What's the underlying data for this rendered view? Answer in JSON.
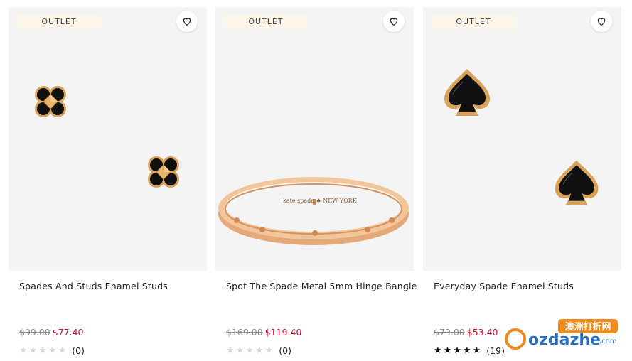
{
  "products": [
    {
      "badge": "OUTLET",
      "name": "Spades And Studs Enamel Studs",
      "old_price": "$99.00",
      "new_price": "$77.40",
      "rating_count": "(0)",
      "stars_filled": 0
    },
    {
      "badge": "OUTLET",
      "name": "Spot The Spade Metal 5mm Hinge Bangle",
      "old_price": "$169.00",
      "new_price": "$119.40",
      "rating_count": "(0)",
      "stars_filled": 0,
      "engraving": "kate spade ♠ NEW YORK"
    },
    {
      "badge": "OUTLET",
      "name": "Everyday Spade Enamel Studs",
      "old_price": "$79.00",
      "new_price": "$53.40",
      "rating_count": "(19)",
      "stars_filled": 5
    }
  ],
  "stars_text": "★★★★★",
  "watermark": {
    "cn_text": "澳洲打折网",
    "logo_text": "ozdazhe",
    "domain_suffix": ".com"
  },
  "colors": {
    "sale_red": "#c8102e",
    "badge_bg": "#fbf5ea",
    "gold": "#d9a25a",
    "enamel": "#111111"
  },
  "icons": [
    "heart-icon",
    "star-icon"
  ]
}
